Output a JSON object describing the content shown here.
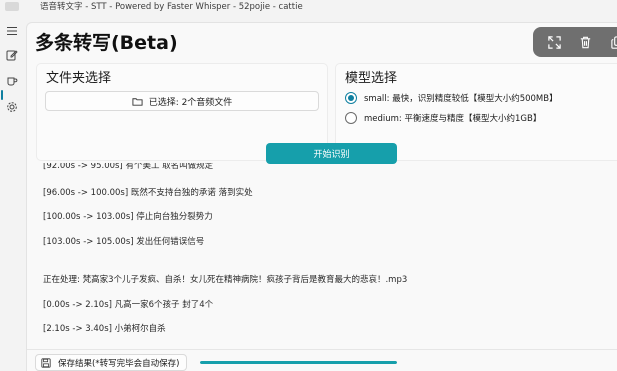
{
  "window": {
    "title": "语音转文字 - STT - Powered by Faster Whisper - 52pojie - cattie"
  },
  "nav": {
    "items": [
      {
        "icon": "hamburger-menu-icon"
      },
      {
        "icon": "edit-icon"
      },
      {
        "icon": "mug-icon",
        "active": true
      },
      {
        "icon": "settings-icon"
      }
    ]
  },
  "overlay": {
    "icons": [
      "expand-icon",
      "delete-icon",
      "copy-icon"
    ]
  },
  "page": {
    "title": "多条转写(Beta)"
  },
  "folder_card": {
    "title": "文件夹选择",
    "select_label": "已选择: 2个音频文件"
  },
  "model_card": {
    "title": "模型选择",
    "options": [
      {
        "label": "small: 最快，识别精度较低【模型大小约500MB】",
        "checked": true
      },
      {
        "label": "medium: 平衡速度与精度【模型大小约1GB】",
        "checked": false
      }
    ]
  },
  "start_button": {
    "label": "开始识别"
  },
  "log": {
    "lines": [
      "[92.00s -> 95.00s] 有个美工 取名叫做规定",
      "[96.00s -> 100.00s] 既然不支持台独的承诺 落到实处",
      "[100.00s -> 103.00s] 停止向台独分裂势力",
      "[103.00s -> 105.00s] 发出任何错误信号",
      "正在处理: 梵高家3个儿子发疯、自杀！女儿死在精神病院！疯孩子背后是教育最大的悲哀！.mp3",
      "[0.00s -> 2.10s] 凡高一家6个孩子 封了4个",
      "[2.10s -> 3.40s] 小弟柯尔自杀"
    ]
  },
  "bottom": {
    "save_label": "保存结果(*转写完毕会自动保存)",
    "progress": 1.0
  },
  "colors": {
    "accent": "#169fab",
    "radio_accent": "#0f7fa0",
    "overlay_bg": "#6f6f6f"
  }
}
